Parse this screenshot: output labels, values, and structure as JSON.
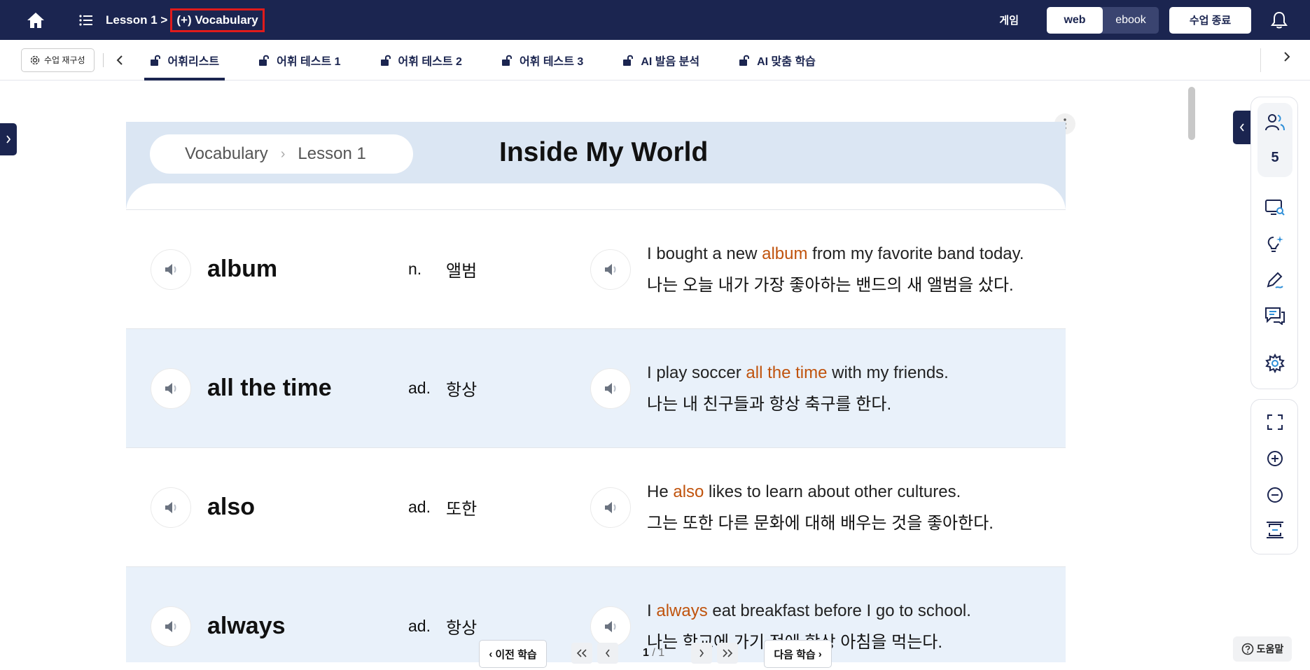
{
  "topbar": {
    "crumb_lesson": "Lesson 1 >",
    "crumb_current": "(+) Vocabulary",
    "game": "게임",
    "view_web": "web",
    "view_ebook": "ebook",
    "end_class": "수업 종료"
  },
  "tabbar": {
    "reconfig": "수업 재구성",
    "tabs": [
      {
        "label": "어휘리스트"
      },
      {
        "label": "어휘 테스트 1"
      },
      {
        "label": "어휘 테스트 2"
      },
      {
        "label": "어휘 테스트 3"
      },
      {
        "label": "AI 발음 분석"
      },
      {
        "label": "AI 맞춤 학습"
      }
    ]
  },
  "header": {
    "crumb_section": "Vocabulary",
    "crumb_lesson": "Lesson 1",
    "title": "Inside My World"
  },
  "rows": [
    {
      "word": "album",
      "pos": "n.",
      "meaning": "앨범",
      "ex_pre": "I bought a new ",
      "ex_kw": "album",
      "ex_post": " from my favorite band today.",
      "ex_ko": "나는 오늘 내가 가장 좋아하는 밴드의 새 앨범을 샀다."
    },
    {
      "word": "all the time",
      "pos": "ad.",
      "meaning": "항상",
      "ex_pre": "I play soccer ",
      "ex_kw": "all the time",
      "ex_post": " with my friends.",
      "ex_ko": "나는 내 친구들과 항상 축구를 한다."
    },
    {
      "word": "also",
      "pos": "ad.",
      "meaning": "또한",
      "ex_pre": "He ",
      "ex_kw": "also",
      "ex_post": " likes to learn about other cultures.",
      "ex_ko": "그는 또한 다른 문화에 대해 배우는 것을 좋아한다."
    },
    {
      "word": "always",
      "pos": "ad.",
      "meaning": "항상",
      "ex_pre": "I ",
      "ex_kw": "always",
      "ex_post": " eat breakfast before I go to school.",
      "ex_ko": "나는 학교에 가기 전에 항상 아침을 먹는다."
    }
  ],
  "right_toolbar": {
    "participant_count": "5"
  },
  "bottomnav": {
    "prev": "이전 학습",
    "next": "다음 학습",
    "page_current": "1",
    "page_total": "/ 1"
  },
  "help": "도움말",
  "colors": {
    "navy": "#1b2550",
    "keyword": "#c0530d",
    "alt_row": "#e9f1fa",
    "header_band": "#dbe6f3",
    "highlight_box": "#e01b1b"
  }
}
